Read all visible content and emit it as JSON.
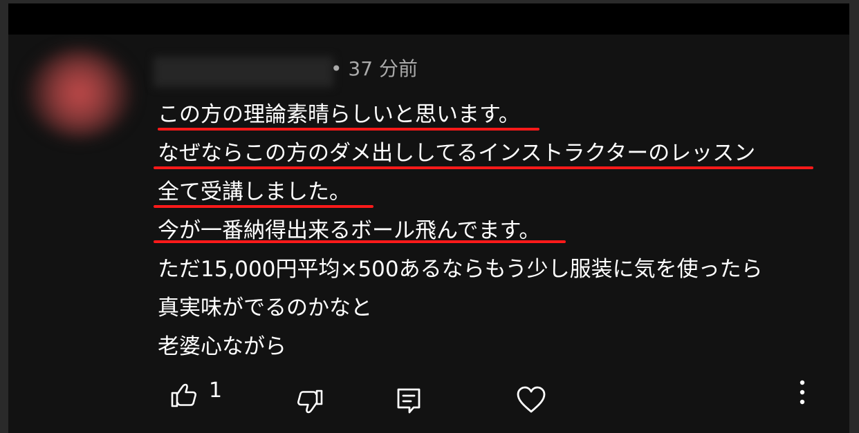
{
  "comment": {
    "author": "",
    "meta": "• 37 分前",
    "lines": [
      "この方の理論素晴らしいと思います。",
      "なぜならこの方のダメ出ししてるインストラクターのレッスン",
      "全て受講しました。",
      "今が一番納得出来るボール飛んでます。",
      "ただ15,000円平均×500あるならもう少し服装に気を使ったら",
      "真実味がでるのかなと",
      "老婆心ながら"
    ],
    "like_count": "1"
  },
  "actions": {
    "like_icon": "thumbs-up-icon",
    "dislike_icon": "thumbs-down-icon",
    "reply_icon": "comment-icon",
    "heart_icon": "heart-icon",
    "more_icon": "more-vertical-icon"
  },
  "colors": {
    "background": "#121212",
    "text": "#ffffff",
    "meta_text": "#aaaaaa",
    "underline": "#ff1a1a"
  }
}
